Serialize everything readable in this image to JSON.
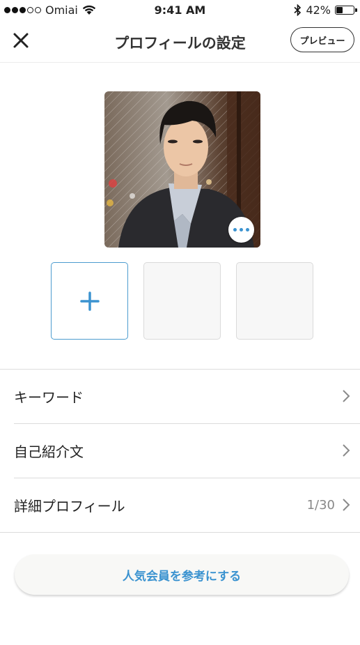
{
  "status_bar": {
    "carrier": "Omiai",
    "time": "9:41 AM",
    "battery_percent": "42%",
    "battery_level": 0.42,
    "signal_bars": 3,
    "signal_total": 5
  },
  "header": {
    "title": "プロフィールの設定",
    "close_icon": "close-icon",
    "preview_label": "プレビュー"
  },
  "photos": {
    "main_alt": "profile photo",
    "more_icon": "more-icon",
    "add_icon": "plus-icon"
  },
  "list": {
    "items": [
      {
        "label": "キーワード",
        "value": ""
      },
      {
        "label": "自己紹介文",
        "value": ""
      },
      {
        "label": "詳細プロフィール",
        "value": "1/30"
      }
    ]
  },
  "actions": {
    "reference_label": "人気会員を参考にする"
  },
  "colors": {
    "accent": "#3b93d0",
    "divider": "#dcdcdc",
    "text": "#222222"
  }
}
